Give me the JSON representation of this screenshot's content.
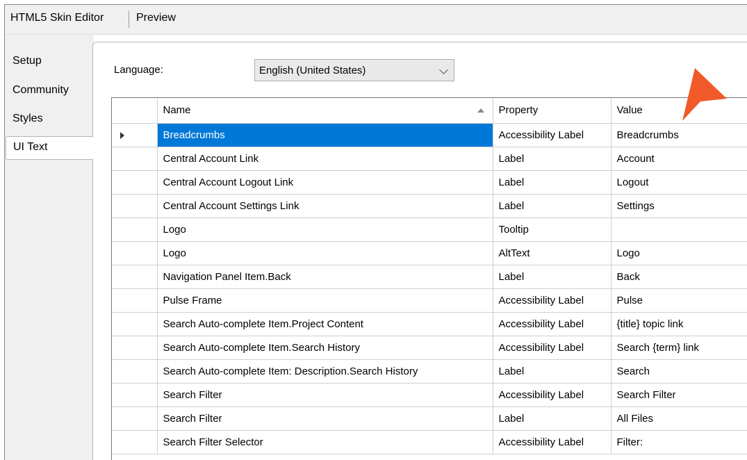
{
  "toolbar": {
    "tabs": [
      {
        "label": "HTML5 Skin Editor"
      },
      {
        "label": "Preview"
      }
    ]
  },
  "sidebar": {
    "tabs": [
      {
        "label": "Setup"
      },
      {
        "label": "Community"
      },
      {
        "label": "Styles"
      },
      {
        "label": "UI Text"
      }
    ],
    "active": "UI Text"
  },
  "language": {
    "label": "Language:",
    "selected": "English (United States)"
  },
  "grid": {
    "columns": {
      "name": "Name",
      "property": "Property",
      "value": "Value"
    },
    "rows": [
      {
        "name": "Breadcrumbs",
        "property": "Accessibility Label",
        "value": "Breadcrumbs"
      },
      {
        "name": "Central Account Link",
        "property": "Label",
        "value": "Account"
      },
      {
        "name": "Central Account Logout Link",
        "property": "Label",
        "value": "Logout"
      },
      {
        "name": "Central Account Settings Link",
        "property": "Label",
        "value": "Settings"
      },
      {
        "name": "Logo",
        "property": "Tooltip",
        "value": ""
      },
      {
        "name": "Logo",
        "property": "AltText",
        "value": "Logo"
      },
      {
        "name": "Navigation Panel Item.Back",
        "property": "Label",
        "value": "Back"
      },
      {
        "name": "Pulse Frame",
        "property": "Accessibility Label",
        "value": "Pulse"
      },
      {
        "name": "Search Auto-complete Item.Project Content",
        "property": "Accessibility Label",
        "value": "{title} topic link"
      },
      {
        "name": "Search Auto-complete Item.Search History",
        "property": "Accessibility Label",
        "value": "Search {term} link"
      },
      {
        "name": "Search Auto-complete Item: Description.Search History",
        "property": "Label",
        "value": "Search"
      },
      {
        "name": "Search Filter",
        "property": "Accessibility Label",
        "value": "Search Filter"
      },
      {
        "name": "Search Filter",
        "property": "Label",
        "value": "All Files"
      },
      {
        "name": "Search Filter Selector",
        "property": "Accessibility Label",
        "value": "Filter:"
      }
    ]
  },
  "colors": {
    "selection": "#0078d7",
    "pointer": "#f05a28"
  }
}
